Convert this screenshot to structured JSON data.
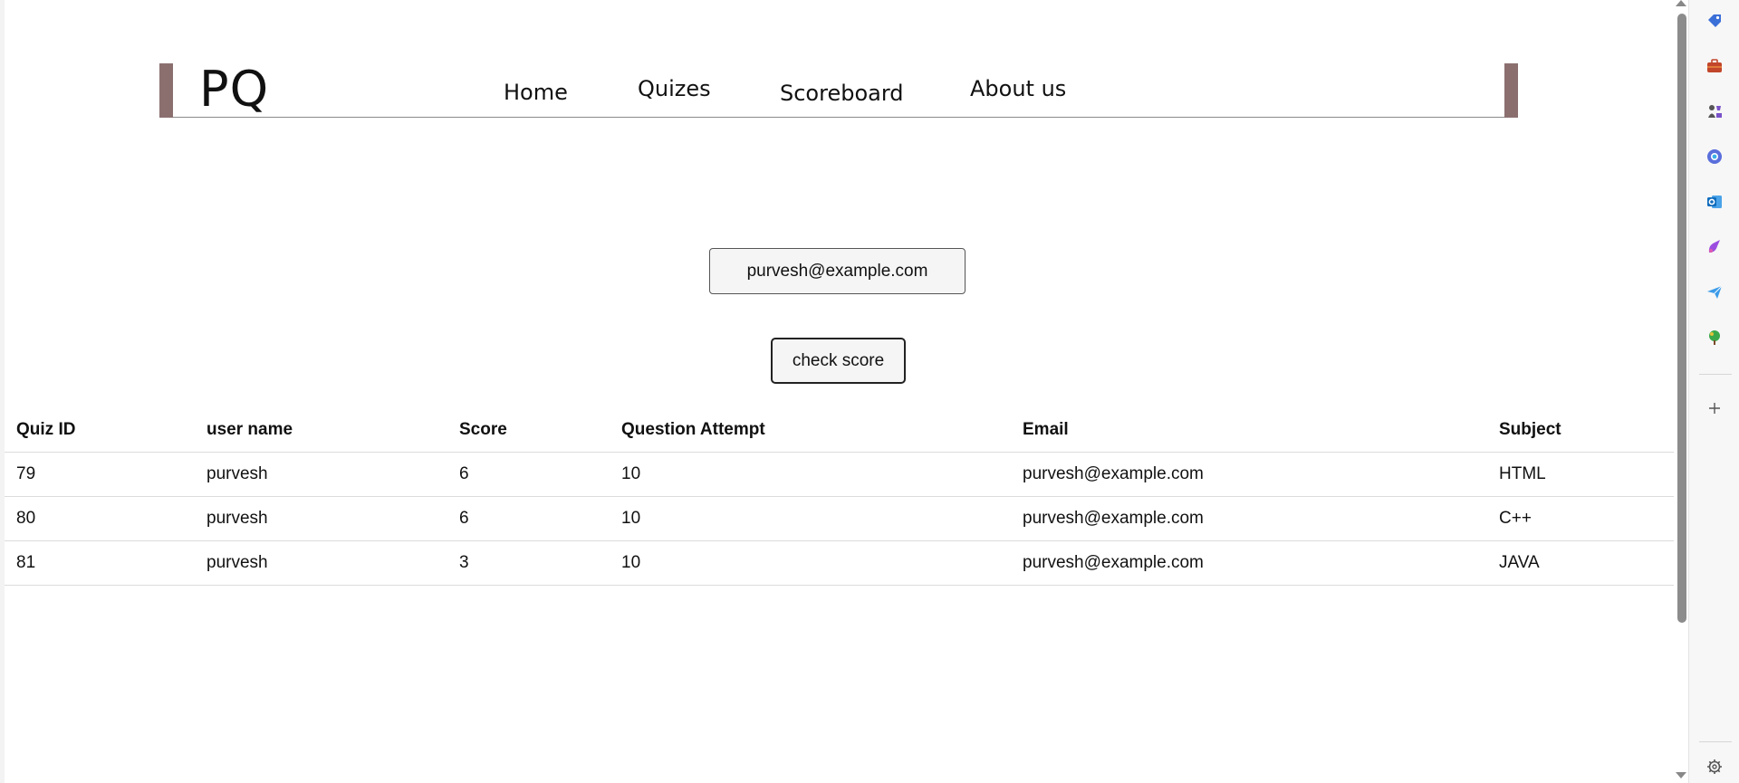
{
  "header": {
    "logo": "PQ",
    "nav": [
      "Home",
      "Quizes",
      "Scoreboard",
      "About us"
    ]
  },
  "form": {
    "email_value": "purvesh@example.com",
    "check_label": "check score"
  },
  "table": {
    "headers": [
      "Quiz ID",
      "user name",
      "Score",
      "Question Attempt",
      "Email",
      "Subject"
    ],
    "rows": [
      [
        "79",
        "purvesh",
        "6",
        "10",
        "purvesh@example.com",
        "HTML"
      ],
      [
        "80",
        "purvesh",
        "6",
        "10",
        "purvesh@example.com",
        "C++"
      ],
      [
        "81",
        "purvesh",
        "3",
        "10",
        "purvesh@example.com",
        "JAVA"
      ]
    ]
  },
  "side_panel": {
    "icons": [
      "tag-icon",
      "briefcase-icon",
      "chess-icon",
      "office-icon",
      "outlook-icon",
      "designer-icon",
      "send-icon",
      "tree-icon",
      "plus-icon",
      "gear-icon"
    ]
  },
  "colors": {
    "header_bar": "#8b6f6f",
    "scroll_thumb": "#8c8c8c"
  }
}
